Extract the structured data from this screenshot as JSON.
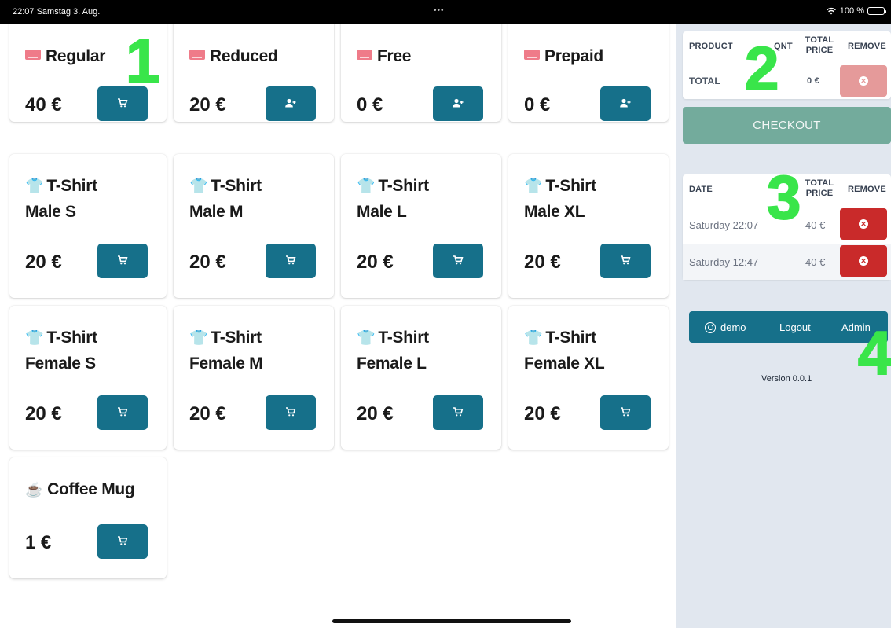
{
  "status_bar": {
    "time_date": "22:07  Samstag 3. Aug.",
    "dots": "•••",
    "battery": "100 %"
  },
  "products": [
    {
      "icon": "ticket-icon",
      "name": "Regular",
      "price": "40 €",
      "action": "cart-icon"
    },
    {
      "icon": "ticket-icon",
      "name": "Reduced",
      "price": "20 €",
      "action": "add-user-icon"
    },
    {
      "icon": "ticket-icon",
      "name": "Free",
      "price": "0 €",
      "action": "add-user-icon"
    },
    {
      "icon": "ticket-icon",
      "name": "Prepaid",
      "price": "0 €",
      "action": "add-user-icon"
    },
    {
      "icon": "tshirt-icon",
      "name": "T-Shirt",
      "name2": "Male S",
      "price": "20 €",
      "action": "cart-icon"
    },
    {
      "icon": "tshirt-icon",
      "name": "T-Shirt",
      "name2": "Male M",
      "price": "20 €",
      "action": "cart-icon"
    },
    {
      "icon": "tshirt-icon",
      "name": "T-Shirt",
      "name2": "Male L",
      "price": "20 €",
      "action": "cart-icon"
    },
    {
      "icon": "tshirt-icon",
      "name": "T-Shirt",
      "name2": "Male XL",
      "price": "20 €",
      "action": "cart-icon"
    },
    {
      "icon": "tshirt-icon",
      "name": "T-Shirt",
      "name2": "Female S",
      "price": "20 €",
      "action": "cart-icon"
    },
    {
      "icon": "tshirt-icon",
      "name": "T-Shirt",
      "name2": "Female M",
      "price": "20 €",
      "action": "cart-icon"
    },
    {
      "icon": "tshirt-icon",
      "name": "T-Shirt",
      "name2": "Female L",
      "price": "20 €",
      "action": "cart-icon"
    },
    {
      "icon": "tshirt-icon",
      "name": "T-Shirt",
      "name2": "Female XL",
      "price": "20 €",
      "action": "cart-icon"
    },
    {
      "icon": "coffee-icon",
      "name": "Coffee Mug",
      "price": "1 €",
      "action": "cart-icon"
    }
  ],
  "annotations": [
    "1",
    "2",
    "3",
    "4"
  ],
  "cart": {
    "headers": {
      "product": "PRODUCT",
      "qnt": "QNT",
      "total_price_1": "TOTAL",
      "total_price_2": "PRICE",
      "remove": "REMOVE"
    },
    "total_label": "TOTAL",
    "total_value": "0 €"
  },
  "checkout_label": "CHECKOUT",
  "history": {
    "headers": {
      "date": "DATE",
      "total_price_1": "TOTAL",
      "total_price_2": "PRICE",
      "remove": "REMOVE"
    },
    "rows": [
      {
        "date": "Saturday 22:07",
        "price": "40 €"
      },
      {
        "date": "Saturday 12:47",
        "price": "40 €"
      }
    ]
  },
  "user_bar": {
    "username": "demo",
    "logout": "Logout",
    "admin": "Admin"
  },
  "version": "Version 0.0.1",
  "colors": {
    "primary": "#16708a",
    "danger": "#c92a2a",
    "checkout": "#73ab9c",
    "sidebar_bg": "#e1e7ef",
    "annotation": "#39e54a"
  }
}
